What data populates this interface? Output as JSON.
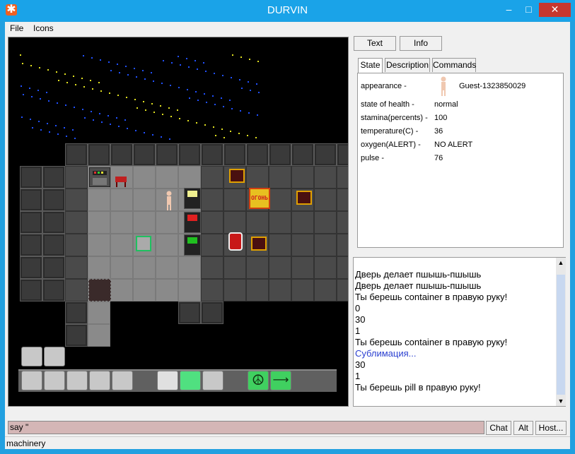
{
  "window": {
    "title": "DURVIN"
  },
  "menu": {
    "file": "File",
    "icons": "Icons"
  },
  "panel_buttons": {
    "text": "Text",
    "info": "Info"
  },
  "tabs": [
    {
      "label": "State"
    },
    {
      "label": "Description"
    },
    {
      "label": "Commands"
    }
  ],
  "state": {
    "appearance_label": "appearance -",
    "appearance_value": "Guest-1323850029",
    "rows": [
      {
        "label": "state of health -",
        "value": "normal"
      },
      {
        "label": "stamina(percents) -",
        "value": "100"
      },
      {
        "label": "temperature(C) -",
        "value": "36"
      },
      {
        "label": "oxygen(ALERT) -",
        "value": "NO ALERT"
      },
      {
        "label": "pulse -",
        "value": "76"
      }
    ]
  },
  "chat_lines": [
    "Дверь делает пшышь-пшышь",
    "Дверь делает пшышь-пшышь",
    "Ты берешь container в правую руку!",
    "0",
    "30",
    "1",
    "Ты берешь container в правую руку!",
    "Сублимация...",
    "30",
    "1",
    "Ты берешь pill в правую руку!"
  ],
  "map": {
    "sign_text": "ОГОНЬ"
  },
  "input": {
    "value": "say \""
  },
  "bottom_buttons": {
    "chat": "Chat",
    "alt": "Alt",
    "host": "Host..."
  },
  "status": {
    "text": "machinery"
  },
  "colors": {
    "titlebar": "#1aa3e8",
    "close": "#c7372f",
    "link_line": "#2a3fd0",
    "input_bg": "#d4b6b6"
  }
}
